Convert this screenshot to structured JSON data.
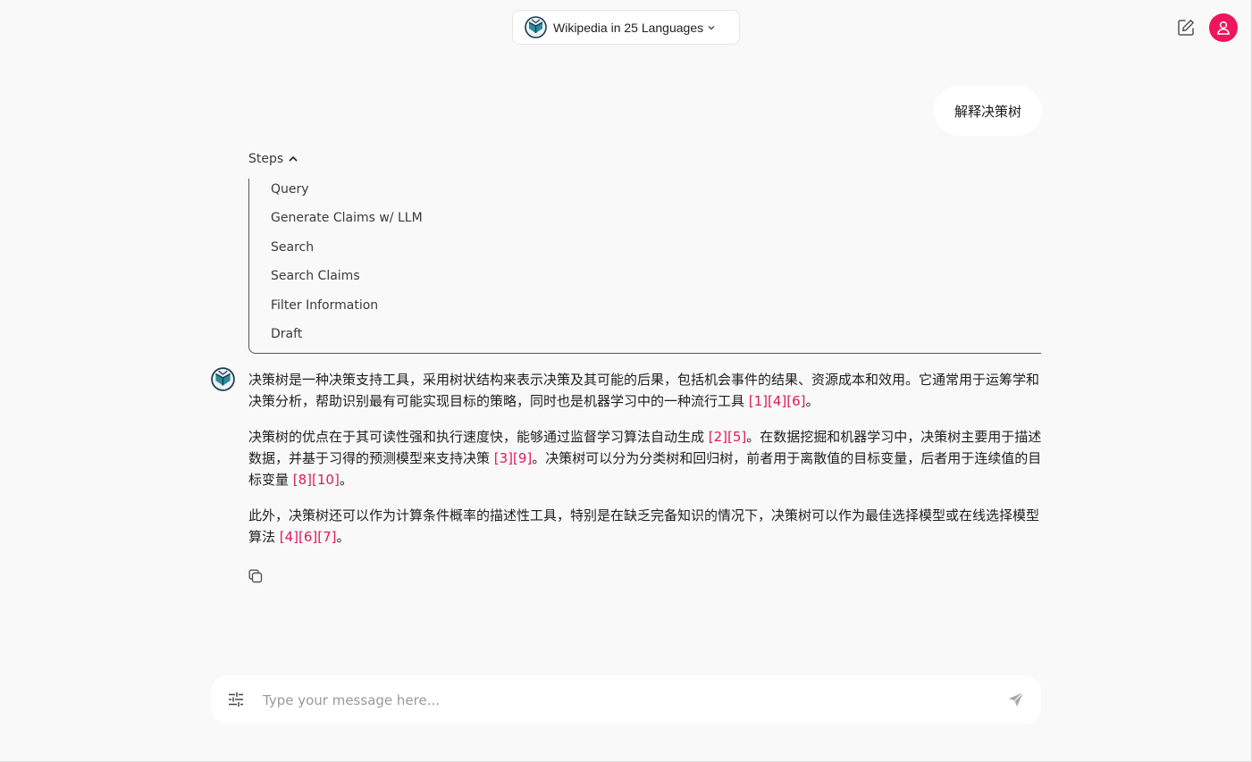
{
  "header": {
    "model_selector": {
      "label": "Wikipedia in 25 Languages",
      "icon": "wikichat-logo-icon"
    },
    "new_chat_icon": "edit-icon",
    "avatar_icon": "user-icon",
    "avatar_color": "#f0145a"
  },
  "conversation": {
    "user_message": "解释决策树",
    "steps": {
      "label": "Steps",
      "items": [
        "Query",
        "Generate Claims w/ LLM",
        "Search",
        "Search Claims",
        "Filter Information",
        "Draft"
      ]
    },
    "answer": {
      "paragraphs": [
        {
          "parts": [
            {
              "text": "决策树是一种决策支持工具，采用树状结构来表示决策及其可能的后果，包括机会事件的结果、资源成本和效用。它通常用于运筹学和决策分析，帮助识别最有可能实现目标的策略，同时也是机器学习中的一种流行工具 "
            },
            {
              "cite": "[1]"
            },
            {
              "cite": "[4]"
            },
            {
              "cite": "[6]"
            },
            {
              "text": "。"
            }
          ]
        },
        {
          "parts": [
            {
              "text": "决策树的优点在于其可读性强和执行速度快，能够通过监督学习算法自动生成 "
            },
            {
              "cite": "[2]"
            },
            {
              "cite": "[5]"
            },
            {
              "text": "。在数据挖掘和机器学习中，决策树主要用于描述数据，并基于习得的预测模型来支持决策 "
            },
            {
              "cite": "[3]"
            },
            {
              "cite": "[9]"
            },
            {
              "text": "。决策树可以分为分类树和回归树，前者用于离散值的目标变量，后者用于连续值的目标变量 "
            },
            {
              "cite": "[8]"
            },
            {
              "cite": "[10]"
            },
            {
              "text": "。"
            }
          ]
        },
        {
          "parts": [
            {
              "text": "此外，决策树还可以作为计算条件概率的描述性工具，特别是在缺乏完备知识的情况下，决策树可以作为最佳选择模型或在线选择模型算法 "
            },
            {
              "cite": "[4]"
            },
            {
              "cite": "[6]"
            },
            {
              "cite": "[7]"
            },
            {
              "text": "。"
            }
          ]
        }
      ],
      "citation_color": "#e0195c",
      "copy_icon": "copy-icon"
    }
  },
  "composer": {
    "placeholder": "Type your message here...",
    "settings_icon": "sliders-icon",
    "send_icon": "send-icon"
  }
}
